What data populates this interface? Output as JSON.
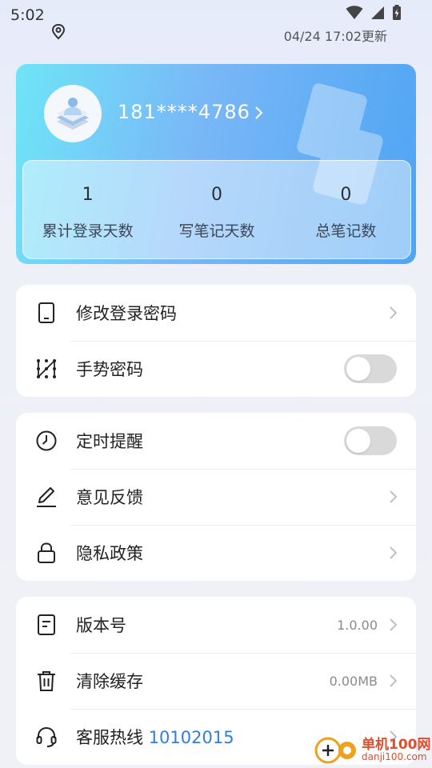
{
  "status_bar": {
    "time": "5:02",
    "update_text": "04/24 17:02更新",
    "icons": [
      "location-icon",
      "wifi-icon",
      "signal-icon",
      "battery-icon"
    ]
  },
  "profile": {
    "phone": "181****4786",
    "stats": [
      {
        "value": "1",
        "label": "累计登录天数"
      },
      {
        "value": "0",
        "label": "写笔记天数"
      },
      {
        "value": "0",
        "label": "总笔记数"
      }
    ]
  },
  "security_group": {
    "change_password": "修改登录密码",
    "gesture_password": "手势密码",
    "gesture_enabled": false
  },
  "settings_group": {
    "reminder": "定时提醒",
    "reminder_enabled": false,
    "feedback": "意见反馈",
    "privacy": "隐私政策"
  },
  "about_group": {
    "version_label": "版本号",
    "version_value": "1.0.00",
    "clear_cache_label": "清除缓存",
    "cache_size": "0.00MB",
    "hotline_label": "客服热线",
    "hotline_number": "10102015"
  },
  "watermark": {
    "name": "单机100网",
    "url": "danji100.com"
  },
  "colors": {
    "accent": "#2f7de1",
    "card_gradient_start": "#6fe4f7",
    "card_gradient_end": "#4fa5f3",
    "toggle_off": "#d9d9d9"
  }
}
